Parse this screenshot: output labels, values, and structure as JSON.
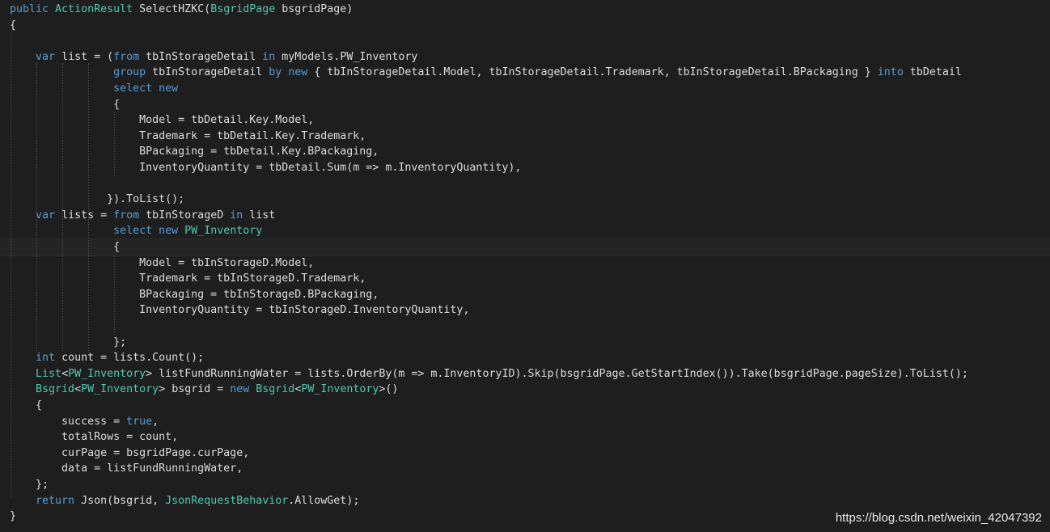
{
  "colors": {
    "background": "#1e1e1e",
    "keyword": "#569cd6",
    "type": "#4ec9b0",
    "identifier": "#dcdcdc",
    "comment": "#57a64a"
  },
  "code": {
    "current_line_index": 15,
    "lines": [
      [
        [
          "kw",
          "public "
        ],
        [
          "ty",
          "ActionResult "
        ],
        [
          "id",
          "SelectHZKC("
        ],
        [
          "ty",
          "BsgridPage "
        ],
        [
          "id",
          "bsgridPage)"
        ]
      ],
      [
        [
          "pn",
          "{"
        ]
      ],
      [],
      [
        [
          "pn",
          "    "
        ],
        [
          "kw",
          "var "
        ],
        [
          "id",
          "list = ("
        ],
        [
          "kw",
          "from "
        ],
        [
          "id",
          "tbInStorageDetail "
        ],
        [
          "kw",
          "in "
        ],
        [
          "id",
          "myModels.PW_Inventory"
        ]
      ],
      [
        [
          "pn",
          "                "
        ],
        [
          "kw",
          "group "
        ],
        [
          "id",
          "tbInStorageDetail "
        ],
        [
          "kw",
          "by "
        ],
        [
          "kw",
          "new "
        ],
        [
          "id",
          "{ tbInStorageDetail.Model, tbInStorageDetail.Trademark, tbInStorageDetail.BPackaging } "
        ],
        [
          "kw",
          "into "
        ],
        [
          "id",
          "tbDetail"
        ]
      ],
      [
        [
          "pn",
          "                "
        ],
        [
          "kw",
          "select "
        ],
        [
          "kw",
          "new"
        ]
      ],
      [
        [
          "pn",
          "                {"
        ]
      ],
      [
        [
          "pn",
          "                    "
        ],
        [
          "id",
          "Model = tbDetail.Key.Model,"
        ]
      ],
      [
        [
          "pn",
          "                    "
        ],
        [
          "id",
          "Trademark = tbDetail.Key.Trademark,"
        ]
      ],
      [
        [
          "pn",
          "                    "
        ],
        [
          "id",
          "BPackaging = tbDetail.Key.BPackaging,"
        ]
      ],
      [
        [
          "pn",
          "                    "
        ],
        [
          "id",
          "InventoryQuantity = tbDetail.Sum(m => m.InventoryQuantity),"
        ]
      ],
      [],
      [
        [
          "pn",
          "               "
        ],
        [
          "id",
          "}).ToList();"
        ]
      ],
      [
        [
          "pn",
          "    "
        ],
        [
          "kw",
          "var "
        ],
        [
          "id",
          "lists = "
        ],
        [
          "kw",
          "from "
        ],
        [
          "id",
          "tbInStorageD "
        ],
        [
          "kw",
          "in "
        ],
        [
          "id",
          "list"
        ]
      ],
      [
        [
          "pn",
          "                "
        ],
        [
          "kw",
          "select "
        ],
        [
          "kw",
          "new "
        ],
        [
          "ty",
          "PW_Inventory"
        ]
      ],
      [
        [
          "pn",
          "                {"
        ]
      ],
      [
        [
          "pn",
          "                    "
        ],
        [
          "id",
          "Model = tbInStorageD.Model,"
        ]
      ],
      [
        [
          "pn",
          "                    "
        ],
        [
          "id",
          "Trademark = tbInStorageD.Trademark,"
        ]
      ],
      [
        [
          "pn",
          "                    "
        ],
        [
          "id",
          "BPackaging = tbInStorageD.BPackaging,"
        ]
      ],
      [
        [
          "pn",
          "                    "
        ],
        [
          "id",
          "InventoryQuantity = tbInStorageD.InventoryQuantity,"
        ]
      ],
      [],
      [
        [
          "pn",
          "                };"
        ]
      ],
      [
        [
          "pn",
          "    "
        ],
        [
          "kw",
          "int "
        ],
        [
          "id",
          "count = lists.Count();"
        ]
      ],
      [
        [
          "pn",
          "    "
        ],
        [
          "ty",
          "List"
        ],
        [
          "pn",
          "<"
        ],
        [
          "ty",
          "PW_Inventory"
        ],
        [
          "pn",
          "> "
        ],
        [
          "id",
          "listFundRunningWater = lists.OrderBy(m => m.InventoryID).Skip(bsgridPage.GetStartIndex()).Take(bsgridPage.pageSize).ToList();"
        ]
      ],
      [
        [
          "pn",
          "    "
        ],
        [
          "ty",
          "Bsgrid"
        ],
        [
          "pn",
          "<"
        ],
        [
          "ty",
          "PW_Inventory"
        ],
        [
          "pn",
          "> "
        ],
        [
          "id",
          "bsgrid = "
        ],
        [
          "kw",
          "new "
        ],
        [
          "ty",
          "Bsgrid"
        ],
        [
          "pn",
          "<"
        ],
        [
          "ty",
          "PW_Inventory"
        ],
        [
          "pn",
          ">()"
        ]
      ],
      [
        [
          "pn",
          "    {"
        ]
      ],
      [
        [
          "pn",
          "        "
        ],
        [
          "id",
          "success = "
        ],
        [
          "kw",
          "true"
        ],
        [
          "id",
          ","
        ]
      ],
      [
        [
          "pn",
          "        "
        ],
        [
          "id",
          "totalRows = count,"
        ]
      ],
      [
        [
          "pn",
          "        "
        ],
        [
          "id",
          "curPage = bsgridPage.curPage,"
        ]
      ],
      [
        [
          "pn",
          "        "
        ],
        [
          "id",
          "data = listFundRunningWater,"
        ]
      ],
      [
        [
          "pn",
          "    };"
        ]
      ],
      [
        [
          "pn",
          "    "
        ],
        [
          "kw",
          "return "
        ],
        [
          "id",
          "Json(bsgrid, "
        ],
        [
          "ty",
          "JsonRequestBehavior"
        ],
        [
          "id",
          ".AllowGet);"
        ]
      ],
      [
        [
          "pn",
          "}"
        ]
      ]
    ]
  },
  "watermark": "https://blog.csdn.net/weixin_42047392"
}
